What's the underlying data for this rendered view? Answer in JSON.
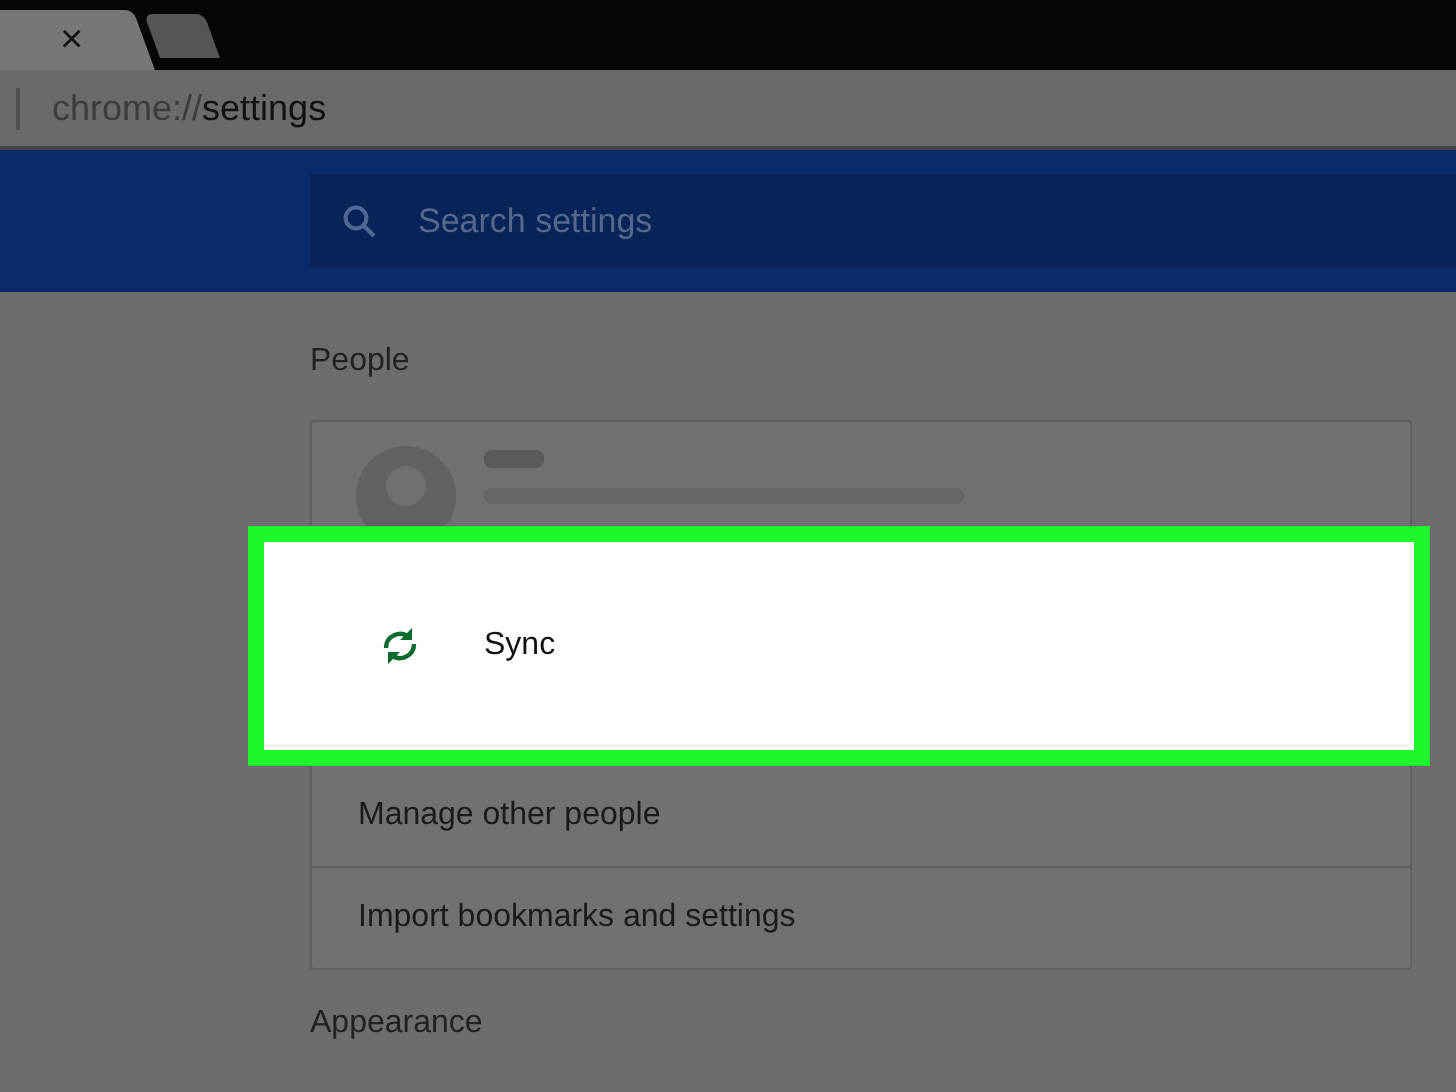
{
  "tabs": [
    {
      "close": "×",
      "selected": true
    },
    {
      "selected": false
    }
  ],
  "address": {
    "scheme": "chrome://",
    "path": "settings"
  },
  "search": {
    "placeholder": "Search settings"
  },
  "sections": [
    {
      "title": "People",
      "rows": [
        {
          "kind": "profile"
        },
        {
          "kind": "sync",
          "label": "Sync",
          "highlighted": true
        },
        {
          "kind": "link",
          "label": "Manage other people"
        },
        {
          "kind": "link",
          "label": "Import bookmarks and settings"
        }
      ]
    },
    {
      "title": "Appearance"
    }
  ]
}
